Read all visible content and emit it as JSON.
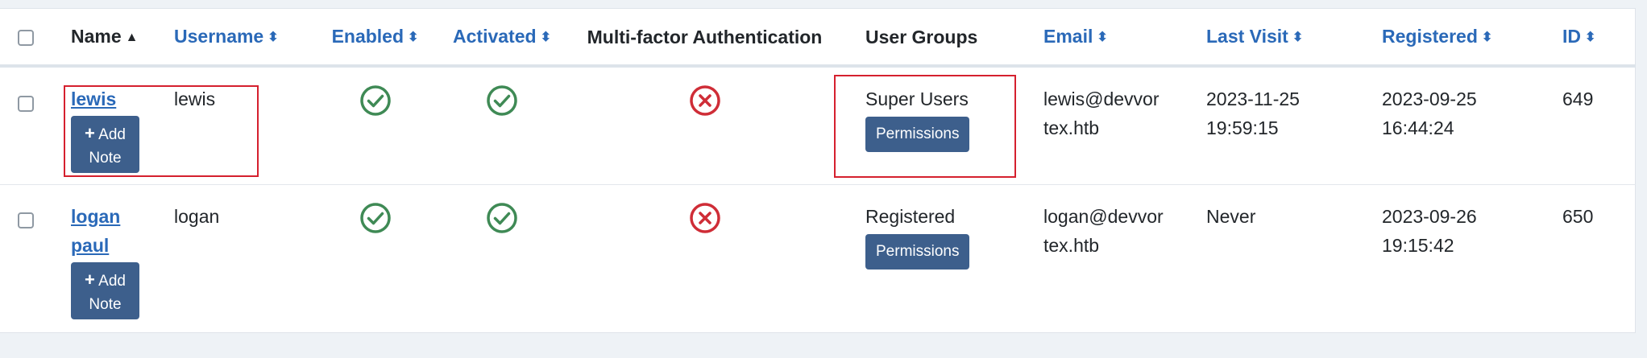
{
  "table": {
    "headers": {
      "name": "Name",
      "username": "Username",
      "enabled": "Enabled",
      "activated": "Activated",
      "mfa": "Multi-factor Authentication",
      "user_groups": "User Groups",
      "email": "Email",
      "last_visit": "Last Visit",
      "registered": "Registered",
      "id": "ID"
    },
    "sort_icons": {
      "asc": "▲",
      "both": "⬍"
    },
    "rows": [
      {
        "name_line1": "lewis",
        "name_line2": "",
        "username": "lewis",
        "enabled": "check-icon",
        "activated": "check-icon",
        "mfa": "x-icon",
        "group": "Super Users",
        "permissions_label": "Permissions",
        "email_line1": "lewis@devvor",
        "email_line2": "tex.htb",
        "last_visit_line1": "2023-11-25",
        "last_visit_line2": "19:59:15",
        "registered_line1": "2023-09-25",
        "registered_line2": "16:44:24",
        "id": "649",
        "add_note_line1": "Add",
        "add_note_line2": "Note"
      },
      {
        "name_line1": "logan",
        "name_line2": "paul",
        "username": "logan",
        "enabled": "check-icon",
        "activated": "check-icon",
        "mfa": "x-icon",
        "group": "Registered",
        "permissions_label": "Permissions",
        "email_line1": "logan@devvor",
        "email_line2": "tex.htb",
        "last_visit_line1": "Never",
        "last_visit_line2": "",
        "registered_line1": "2023-09-26",
        "registered_line2": "19:15:42",
        "id": "650",
        "add_note_line1": "Add",
        "add_note_line2": "Note"
      }
    ]
  },
  "colors": {
    "link": "#2a69b8",
    "button": "#3d5f8c",
    "success": "#3f8a55",
    "danger": "#cf2d37",
    "highlight": "#d5202e"
  }
}
